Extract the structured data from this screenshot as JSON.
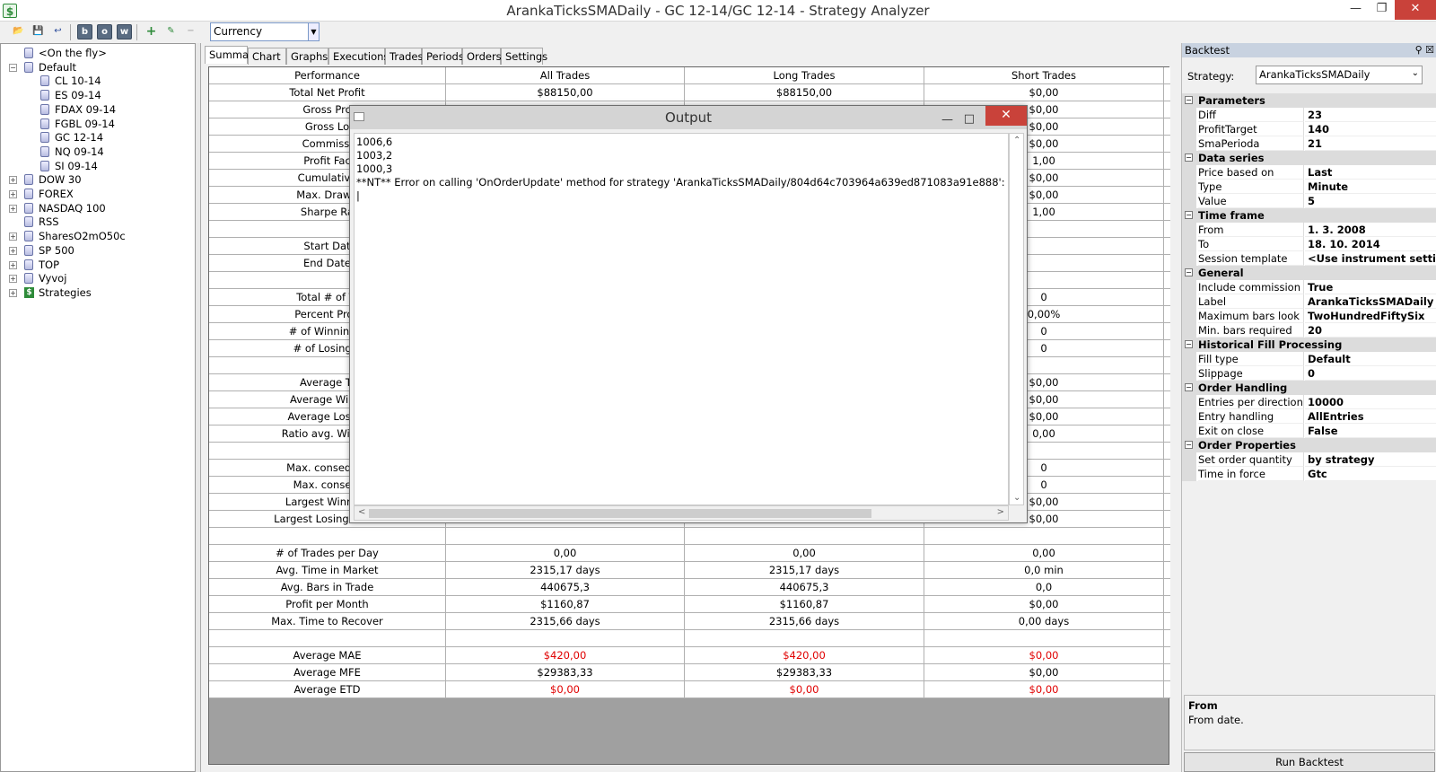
{
  "window": {
    "title": "ArankaTicksSMADaily - GC 12-14/GC 12-14 - Strategy Analyzer"
  },
  "toolbar": {
    "currency_value": "Currency"
  },
  "tree": {
    "items": [
      {
        "label": "<On the fly>",
        "level": 1,
        "expand": "",
        "icon": "db"
      },
      {
        "label": "Default",
        "level": 0,
        "expand": "−",
        "icon": "db"
      },
      {
        "label": "CL 10-14",
        "level": 2,
        "expand": "",
        "icon": "db"
      },
      {
        "label": "ES 09-14",
        "level": 2,
        "expand": "",
        "icon": "db"
      },
      {
        "label": "FDAX 09-14",
        "level": 2,
        "expand": "",
        "icon": "db"
      },
      {
        "label": "FGBL 09-14",
        "level": 2,
        "expand": "",
        "icon": "db"
      },
      {
        "label": "GC 12-14",
        "level": 2,
        "expand": "",
        "icon": "db"
      },
      {
        "label": "NQ 09-14",
        "level": 2,
        "expand": "",
        "icon": "db"
      },
      {
        "label": "SI 09-14",
        "level": 2,
        "expand": "",
        "icon": "db"
      },
      {
        "label": "DOW 30",
        "level": 0,
        "expand": "+",
        "icon": "db"
      },
      {
        "label": "FOREX",
        "level": 0,
        "expand": "+",
        "icon": "db"
      },
      {
        "label": "NASDAQ 100",
        "level": 0,
        "expand": "+",
        "icon": "db"
      },
      {
        "label": "RSS",
        "level": 1,
        "expand": "",
        "icon": "db"
      },
      {
        "label": "SharesO2mO50c",
        "level": 0,
        "expand": "+",
        "icon": "db"
      },
      {
        "label": "SP 500",
        "level": 0,
        "expand": "+",
        "icon": "db"
      },
      {
        "label": "TOP",
        "level": 0,
        "expand": "+",
        "icon": "db"
      },
      {
        "label": "Vyvoj",
        "level": 0,
        "expand": "+",
        "icon": "db"
      },
      {
        "label": "Strategies",
        "level": 0,
        "expand": "+",
        "icon": "dollar"
      }
    ]
  },
  "tabs": [
    "Summary",
    "Chart",
    "Graphs",
    "Executions",
    "Trades",
    "Periods",
    "Orders",
    "Settings"
  ],
  "summary": {
    "headers": [
      "Performance",
      "All Trades",
      "Long Trades",
      "Short Trades"
    ],
    "rows": [
      {
        "label": "Total Net Profit",
        "all": "$88150,00",
        "long": "$88150,00",
        "short": "$0,00"
      },
      {
        "label": "Gross Pro",
        "all": "",
        "long": "",
        "short": "$0,00"
      },
      {
        "label": "Gross Lo",
        "all": "",
        "long": "",
        "short": "$0,00"
      },
      {
        "label": "Commissi",
        "all": "",
        "long": "",
        "short": "$0,00"
      },
      {
        "label": "Profit Fac",
        "all": "",
        "long": "",
        "short": "1,00"
      },
      {
        "label": "Cumulative",
        "all": "",
        "long": "",
        "short": "$0,00"
      },
      {
        "label": "Max. Drawd",
        "all": "",
        "long": "",
        "short": "$0,00"
      },
      {
        "label": "Sharpe Ra",
        "all": "",
        "long": "",
        "short": "1,00"
      },
      {
        "label": "",
        "all": "",
        "long": "",
        "short": ""
      },
      {
        "label": "Start Dat",
        "all": "",
        "long": "",
        "short": ""
      },
      {
        "label": "End Date",
        "all": "",
        "long": "",
        "short": ""
      },
      {
        "label": "",
        "all": "",
        "long": "",
        "short": ""
      },
      {
        "label": "Total # of Tr",
        "all": "",
        "long": "",
        "short": "0"
      },
      {
        "label": "Percent Profi",
        "all": "",
        "long": "",
        "short": "0,00%"
      },
      {
        "label": "# of Winning T",
        "all": "",
        "long": "",
        "short": "0"
      },
      {
        "label": "# of Losing T",
        "all": "",
        "long": "",
        "short": "0"
      },
      {
        "label": "",
        "all": "",
        "long": "",
        "short": ""
      },
      {
        "label": "Average Tr",
        "all": "",
        "long": "",
        "short": "$0,00"
      },
      {
        "label": "Average Winni",
        "all": "",
        "long": "",
        "short": "$0,00"
      },
      {
        "label": "Average Losing",
        "all": "",
        "long": "",
        "short": "$0,00"
      },
      {
        "label": "Ratio avg. Win / a",
        "all": "",
        "long": "",
        "short": "0,00"
      },
      {
        "label": "",
        "all": "",
        "long": "",
        "short": ""
      },
      {
        "label": "Max. conseq. W",
        "all": "",
        "long": "",
        "short": "0"
      },
      {
        "label": "Max. conseq.",
        "all": "",
        "long": "",
        "short": "0"
      },
      {
        "label": "Largest Winning",
        "all": "",
        "long": "",
        "short": "$0,00"
      },
      {
        "label": "Largest Losing Trade",
        "all": "",
        "long": "",
        "short": "$0,00"
      },
      {
        "label": "",
        "all": "",
        "long": "",
        "short": ""
      },
      {
        "label": "# of Trades per Day",
        "all": "0,00",
        "long": "0,00",
        "short": "0,00"
      },
      {
        "label": "Avg. Time in Market",
        "all": "2315,17 days",
        "long": "2315,17 days",
        "short": "0,0 min"
      },
      {
        "label": "Avg. Bars in Trade",
        "all": "440675,3",
        "long": "440675,3",
        "short": "0,0"
      },
      {
        "label": "Profit per Month",
        "all": "$1160,87",
        "long": "$1160,87",
        "short": "$0,00"
      },
      {
        "label": "Max. Time to Recover",
        "all": "2315,66 days",
        "long": "2315,66 days",
        "short": "0,00 days"
      },
      {
        "label": "",
        "all": "",
        "long": "",
        "short": ""
      },
      {
        "label": "Average MAE",
        "all": "$420,00",
        "long": "$420,00",
        "short": "$0,00",
        "red": true
      },
      {
        "label": "Average MFE",
        "all": "$29383,33",
        "long": "$29383,33",
        "short": "$0,00"
      },
      {
        "label": "Average ETD",
        "all": "$0,00",
        "long": "$0,00",
        "short": "$0,00",
        "red": true
      }
    ]
  },
  "output": {
    "title": "Output",
    "lines": [
      "1006,6",
      "1003,2",
      "1000,3",
      "**NT** Error on calling 'OnOrderUpdate' method for strategy 'ArankaTicksSMADaily/804d64c703964a639ed871083a91e888': More tha"
    ]
  },
  "backtest": {
    "header": "Backtest",
    "strategy_label": "Strategy:",
    "strategy_value": "ArankaTicksSMADaily",
    "groups": [
      {
        "name": "Parameters",
        "props": [
          {
            "name": "Diff",
            "value": "23"
          },
          {
            "name": "ProfitTarget",
            "value": "140"
          },
          {
            "name": "SmaPerioda",
            "value": "21"
          }
        ]
      },
      {
        "name": "Data series",
        "props": [
          {
            "name": "Price based on",
            "value": "Last"
          },
          {
            "name": "Type",
            "value": "Minute"
          },
          {
            "name": "Value",
            "value": "5"
          }
        ]
      },
      {
        "name": "Time frame",
        "props": [
          {
            "name": "From",
            "value": "1. 3. 2008"
          },
          {
            "name": "To",
            "value": "18. 10. 2014"
          },
          {
            "name": "Session template",
            "value": "<Use instrument settings>"
          }
        ]
      },
      {
        "name": "General",
        "props": [
          {
            "name": "Include commission",
            "value": "True"
          },
          {
            "name": "Label",
            "value": "ArankaTicksSMADaily"
          },
          {
            "name": "Maximum bars look back",
            "value": "TwoHundredFiftySix"
          },
          {
            "name": "Min. bars required",
            "value": "20"
          }
        ]
      },
      {
        "name": "Historical Fill Processing",
        "props": [
          {
            "name": "Fill type",
            "value": "Default"
          },
          {
            "name": "Slippage",
            "value": "0"
          }
        ]
      },
      {
        "name": "Order Handling",
        "props": [
          {
            "name": "Entries per direction",
            "value": "10000"
          },
          {
            "name": "Entry handling",
            "value": "AllEntries"
          },
          {
            "name": "Exit on close",
            "value": "False"
          }
        ]
      },
      {
        "name": "Order Properties",
        "props": [
          {
            "name": "Set order quantity",
            "value": "by strategy"
          },
          {
            "name": "Time in force",
            "value": "Gtc"
          }
        ]
      }
    ],
    "help_title": "From",
    "help_text": "From date.",
    "run_label": "Run Backtest"
  }
}
